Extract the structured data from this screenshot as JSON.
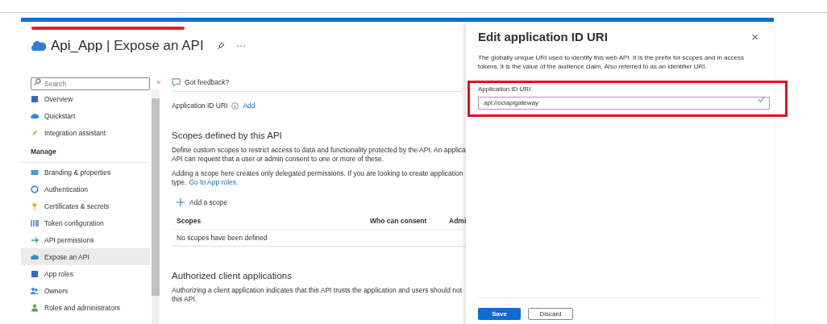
{
  "page": {
    "app_name": "Api_App",
    "separator": "|",
    "section": "Expose an API"
  },
  "sidebar": {
    "search": {
      "placeholder": "Search"
    },
    "collapse": "«",
    "items": [
      {
        "label": "Overview",
        "kind": "item",
        "selected": false
      },
      {
        "label": "Quickstart",
        "kind": "item",
        "selected": false
      },
      {
        "label": "Integration assistant",
        "kind": "item",
        "selected": false
      },
      {
        "label": "Manage",
        "kind": "header"
      },
      {
        "label": "Branding & properties",
        "kind": "item",
        "selected": false
      },
      {
        "label": "Authentication",
        "kind": "item",
        "selected": false
      },
      {
        "label": "Certificates & secrets",
        "kind": "item",
        "selected": false
      },
      {
        "label": "Token configuration",
        "kind": "item",
        "selected": false
      },
      {
        "label": "API permissions",
        "kind": "item",
        "selected": false
      },
      {
        "label": "Expose an API",
        "kind": "item",
        "selected": true
      },
      {
        "label": "App roles",
        "kind": "item",
        "selected": false
      },
      {
        "label": "Owners",
        "kind": "item",
        "selected": false
      },
      {
        "label": "Roles and administrators",
        "kind": "item",
        "selected": false
      }
    ]
  },
  "content": {
    "feedback": "Got feedback?",
    "app_id_label": "Application ID URI",
    "app_id_link": "Add",
    "scopes": {
      "title": "Scopes defined by this API",
      "paragraphs": [
        {
          "lines": [
            "Define custom scopes to restrict access to data and functionality protected by the API. An applica",
            "API can request that a user or admin consent to one or more of these."
          ]
        },
        {
          "lines": [
            "Adding a scope here creates only delegated permissions. If you are looking to create application",
            "type."
          ],
          "link": "Go to App roles."
        }
      ],
      "add_button": "Add a scope",
      "columns": [
        "Scopes",
        "Who can consent",
        "Admi"
      ],
      "empty": "No scopes have been defined"
    },
    "authorized": {
      "title": "Authorized client applications",
      "lines": [
        "Authorizing a client application indicates that this API trusts the application and users should not",
        "this API."
      ]
    }
  },
  "panel": {
    "title": "Edit application ID URI",
    "close": "×",
    "description": "The globally unique URI used to identify this web API. It is the prefix for scopes and in access tokens, it is the value of the audience claim. Also referred to as an identifier URI.",
    "field": {
      "label": "Application ID URI",
      "value": "api://ociapigateway",
      "valid": true
    },
    "buttons": [
      {
        "label": "Save",
        "kind": "primary"
      },
      {
        "label": "Discard",
        "kind": "secondary"
      }
    ]
  }
}
